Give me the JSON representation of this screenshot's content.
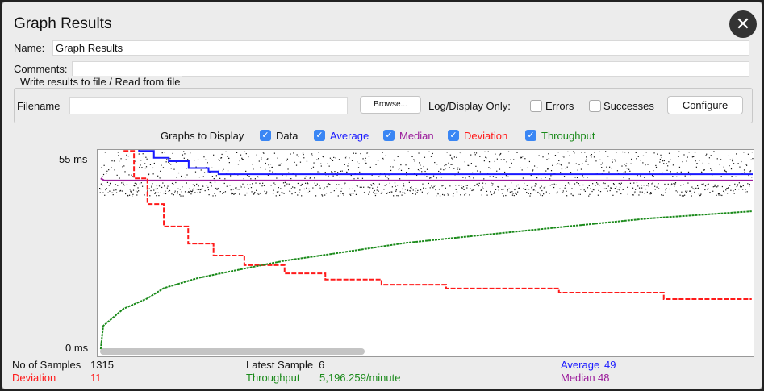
{
  "window": {
    "title": "Graph Results"
  },
  "form": {
    "name_label": "Name:",
    "name_value": "Graph Results",
    "comments_label": "Comments:",
    "comments_value": ""
  },
  "file": {
    "legend": "Write results to file / Read from file",
    "filename_label": "Filename",
    "filename_value": "",
    "browse": "Browse...",
    "log_label": "Log/Display Only:",
    "errors": "Errors",
    "successes": "Successes",
    "configure": "Configure",
    "errors_checked": false,
    "successes_checked": false
  },
  "graphs": {
    "label": "Graphs to Display",
    "items": [
      {
        "label": "Data",
        "color": "#111111",
        "checked": true
      },
      {
        "label": "Average",
        "color": "#1a1aff",
        "checked": true
      },
      {
        "label": "Median",
        "color": "#9a1a9a",
        "checked": true
      },
      {
        "label": "Deviation",
        "color": "#ff1a1a",
        "checked": true
      },
      {
        "label": "Throughput",
        "color": "#1a8a1a",
        "checked": true
      }
    ]
  },
  "chart_data": {
    "type": "line",
    "ylabel_top": "55 ms",
    "ylabel_bottom": "0 ms",
    "ylim": [
      0,
      55
    ],
    "xlim": [
      0,
      1315
    ],
    "series": [
      {
        "name": "Average",
        "color": "#1a1aff",
        "x": [
          49,
          80,
          110,
          140,
          180,
          220,
          240,
          1315
        ],
        "y": [
          60,
          58,
          56,
          55,
          53,
          52,
          51.2,
          51.2
        ]
      },
      {
        "name": "Median",
        "color": "#9a1a9a",
        "x": [
          3,
          10,
          1315
        ],
        "y": [
          50,
          49.4,
          49.4
        ]
      },
      {
        "name": "Deviation",
        "color": "#ff1a1a",
        "x": [
          49,
          70,
          97,
          130,
          179,
          230,
          292,
          373,
          455,
          568,
          617,
          698,
          779,
          925,
          1136,
          1313
        ],
        "y": [
          58,
          50,
          42.5,
          36,
          31,
          27.5,
          24.7,
          22.3,
          20.5,
          19,
          19,
          17.9,
          17.9,
          16.7,
          14.8,
          14.8
        ]
      },
      {
        "name": "Throughput",
        "color": "#1a8a1a",
        "x": [
          3,
          8,
          49,
          97,
          130,
          200,
          292,
          373,
          455,
          617,
          779,
          942,
          1104,
          1313
        ],
        "y": [
          0.2,
          7,
          12,
          15,
          18,
          21,
          23.7,
          26,
          27.7,
          31.2,
          33.6,
          36,
          38.3,
          40.4
        ]
      }
    ]
  },
  "stats": {
    "samples_label": "No of Samples",
    "samples": "1315",
    "latest_label": "Latest Sample",
    "latest": "6",
    "average_label": "Average",
    "average": "49",
    "deviation_label": "Deviation",
    "deviation": "11",
    "throughput_label": "Throughput",
    "throughput": "5,196.259/minute",
    "median_label": "Median",
    "median": "48"
  }
}
